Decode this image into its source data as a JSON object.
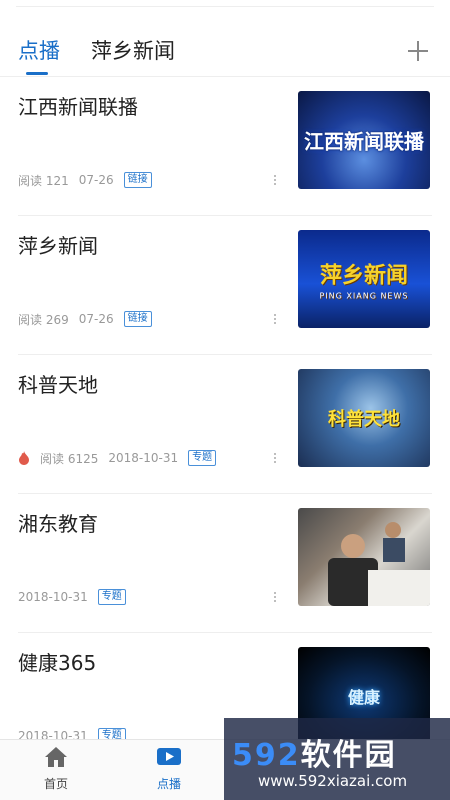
{
  "tabs": [
    {
      "label": "点播"
    },
    {
      "label": "萍乡新闻"
    }
  ],
  "items": [
    {
      "title": "江西新闻联播",
      "reads_label": "阅读",
      "reads": "121",
      "date": "07-26",
      "tag": "链接",
      "thumb_text": "江西新闻联播"
    },
    {
      "title": "萍乡新闻",
      "reads_label": "阅读",
      "reads": "269",
      "date": "07-26",
      "tag": "链接",
      "thumb_text": "萍乡新闻",
      "thumb_sub": "PING XIANG NEWS"
    },
    {
      "title": "科普天地",
      "reads_label": "阅读",
      "reads": "6125",
      "date": "2018-10-31",
      "tag": "专题",
      "hot": true,
      "thumb_text": "科普天地"
    },
    {
      "title": "湘东教育",
      "date": "2018-10-31",
      "tag": "专题"
    },
    {
      "title": "健康365",
      "date": "2018-10-31",
      "tag": "专题",
      "thumb_text": "健康"
    }
  ],
  "nav": {
    "home_label": "首页",
    "vod_label": "点播"
  },
  "watermark": {
    "num": "592",
    "cn": "软件园",
    "url": "www.592xiazai.com"
  },
  "colors": {
    "accent": "#1a6fc8",
    "tag_border": "#4a90d9",
    "hot": "#e05a4b"
  }
}
